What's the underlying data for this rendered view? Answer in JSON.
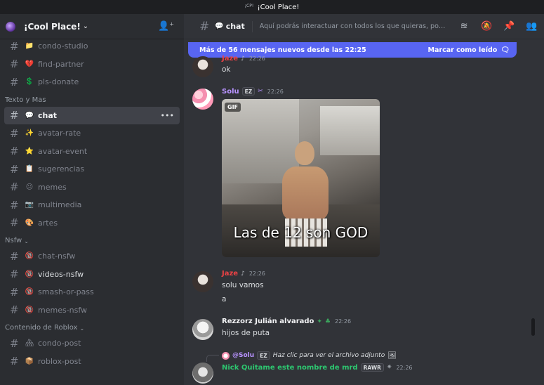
{
  "window": {
    "icon_label": "¡CP!",
    "title": "¡Cool Place!"
  },
  "server": {
    "name": "¡Cool Place!"
  },
  "sidebar": {
    "top_channels": [
      {
        "emoji": "📁",
        "name": "condo-studio"
      },
      {
        "emoji": "💔",
        "name": "find-partner"
      },
      {
        "emoji": "💲",
        "name": "pls-donate"
      }
    ],
    "categories": [
      {
        "name": "Texto y Mas",
        "channels": [
          {
            "emoji": "💬",
            "name": "chat",
            "active": true
          },
          {
            "emoji": "✨",
            "name": "avatar-rate"
          },
          {
            "emoji": "⭐",
            "name": "avatar-event"
          },
          {
            "emoji": "📋",
            "name": "sugerencias"
          },
          {
            "emoji": "😕",
            "name": "memes"
          },
          {
            "emoji": "📷",
            "name": "multimedia"
          },
          {
            "emoji": "🎨",
            "name": "artes"
          }
        ]
      },
      {
        "name": "Nsfw",
        "channels": [
          {
            "emoji": "🔞",
            "name": "chat-nsfw"
          },
          {
            "emoji": "🔞",
            "name": "videos-nsfw"
          },
          {
            "emoji": "🔞",
            "name": "smash-or-pass"
          },
          {
            "emoji": "🔞",
            "name": "memes-nsfw"
          }
        ]
      },
      {
        "name": "Contenido de Roblox",
        "channels": [
          {
            "emoji": "🏘",
            "name": "condo-post"
          },
          {
            "emoji": "📦",
            "name": "roblox-post"
          }
        ]
      }
    ]
  },
  "topbar": {
    "emoji": "💬",
    "channel_name": "chat",
    "topic": "Aquí podrás interactuar con todos los que quieras, podrás"
  },
  "banner": {
    "text": "Más de 56 mensajes nuevos desde las 22:25",
    "action": "Marcar como leído"
  },
  "messages": {
    "m0": {
      "user": "Jaze",
      "time": "22:26",
      "text": "ok"
    },
    "m1": {
      "user": "Solu",
      "badge": "EZ",
      "time": "22:26",
      "gif_tag": "GIF",
      "gif_caption": "Las de 12 son GOD"
    },
    "m2": {
      "user": "Jaze",
      "time": "22:26",
      "line1": "solu vamos",
      "line2": "a"
    },
    "m3": {
      "user": "Rezzorz Julián alvarado",
      "time": "22:26",
      "text": "hijos de puta"
    },
    "m4": {
      "reply_user": "@Solu",
      "reply_badge": "EZ",
      "reply_text": "Haz clic para ver el archivo adjunto",
      "user": "Nick Quitame este nombre de mrd",
      "badge": "RAWR",
      "time": "22:26"
    }
  },
  "colors": {
    "accent": "#5865f2",
    "jaze": "#ed4245",
    "solu": "#b893ff",
    "nick": "#2dc770"
  }
}
